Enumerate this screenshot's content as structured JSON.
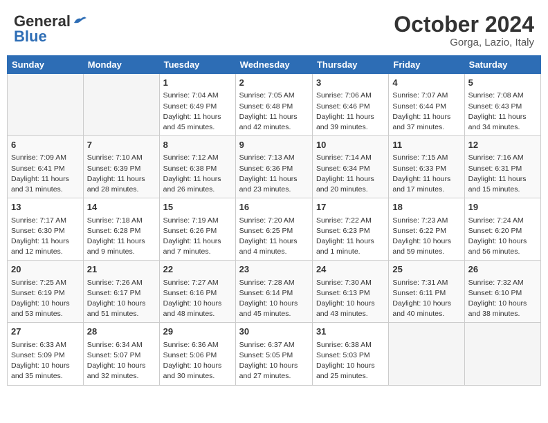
{
  "header": {
    "logo_general": "General",
    "logo_blue": "Blue",
    "month": "October 2024",
    "location": "Gorga, Lazio, Italy"
  },
  "weekdays": [
    "Sunday",
    "Monday",
    "Tuesday",
    "Wednesday",
    "Thursday",
    "Friday",
    "Saturday"
  ],
  "weeks": [
    [
      {
        "day": "",
        "empty": true
      },
      {
        "day": "",
        "empty": true
      },
      {
        "day": "1",
        "sunrise": "Sunrise: 7:04 AM",
        "sunset": "Sunset: 6:49 PM",
        "daylight": "Daylight: 11 hours and 45 minutes."
      },
      {
        "day": "2",
        "sunrise": "Sunrise: 7:05 AM",
        "sunset": "Sunset: 6:48 PM",
        "daylight": "Daylight: 11 hours and 42 minutes."
      },
      {
        "day": "3",
        "sunrise": "Sunrise: 7:06 AM",
        "sunset": "Sunset: 6:46 PM",
        "daylight": "Daylight: 11 hours and 39 minutes."
      },
      {
        "day": "4",
        "sunrise": "Sunrise: 7:07 AM",
        "sunset": "Sunset: 6:44 PM",
        "daylight": "Daylight: 11 hours and 37 minutes."
      },
      {
        "day": "5",
        "sunrise": "Sunrise: 7:08 AM",
        "sunset": "Sunset: 6:43 PM",
        "daylight": "Daylight: 11 hours and 34 minutes."
      }
    ],
    [
      {
        "day": "6",
        "sunrise": "Sunrise: 7:09 AM",
        "sunset": "Sunset: 6:41 PM",
        "daylight": "Daylight: 11 hours and 31 minutes."
      },
      {
        "day": "7",
        "sunrise": "Sunrise: 7:10 AM",
        "sunset": "Sunset: 6:39 PM",
        "daylight": "Daylight: 11 hours and 28 minutes."
      },
      {
        "day": "8",
        "sunrise": "Sunrise: 7:12 AM",
        "sunset": "Sunset: 6:38 PM",
        "daylight": "Daylight: 11 hours and 26 minutes."
      },
      {
        "day": "9",
        "sunrise": "Sunrise: 7:13 AM",
        "sunset": "Sunset: 6:36 PM",
        "daylight": "Daylight: 11 hours and 23 minutes."
      },
      {
        "day": "10",
        "sunrise": "Sunrise: 7:14 AM",
        "sunset": "Sunset: 6:34 PM",
        "daylight": "Daylight: 11 hours and 20 minutes."
      },
      {
        "day": "11",
        "sunrise": "Sunrise: 7:15 AM",
        "sunset": "Sunset: 6:33 PM",
        "daylight": "Daylight: 11 hours and 17 minutes."
      },
      {
        "day": "12",
        "sunrise": "Sunrise: 7:16 AM",
        "sunset": "Sunset: 6:31 PM",
        "daylight": "Daylight: 11 hours and 15 minutes."
      }
    ],
    [
      {
        "day": "13",
        "sunrise": "Sunrise: 7:17 AM",
        "sunset": "Sunset: 6:30 PM",
        "daylight": "Daylight: 11 hours and 12 minutes."
      },
      {
        "day": "14",
        "sunrise": "Sunrise: 7:18 AM",
        "sunset": "Sunset: 6:28 PM",
        "daylight": "Daylight: 11 hours and 9 minutes."
      },
      {
        "day": "15",
        "sunrise": "Sunrise: 7:19 AM",
        "sunset": "Sunset: 6:26 PM",
        "daylight": "Daylight: 11 hours and 7 minutes."
      },
      {
        "day": "16",
        "sunrise": "Sunrise: 7:20 AM",
        "sunset": "Sunset: 6:25 PM",
        "daylight": "Daylight: 11 hours and 4 minutes."
      },
      {
        "day": "17",
        "sunrise": "Sunrise: 7:22 AM",
        "sunset": "Sunset: 6:23 PM",
        "daylight": "Daylight: 11 hours and 1 minute."
      },
      {
        "day": "18",
        "sunrise": "Sunrise: 7:23 AM",
        "sunset": "Sunset: 6:22 PM",
        "daylight": "Daylight: 10 hours and 59 minutes."
      },
      {
        "day": "19",
        "sunrise": "Sunrise: 7:24 AM",
        "sunset": "Sunset: 6:20 PM",
        "daylight": "Daylight: 10 hours and 56 minutes."
      }
    ],
    [
      {
        "day": "20",
        "sunrise": "Sunrise: 7:25 AM",
        "sunset": "Sunset: 6:19 PM",
        "daylight": "Daylight: 10 hours and 53 minutes."
      },
      {
        "day": "21",
        "sunrise": "Sunrise: 7:26 AM",
        "sunset": "Sunset: 6:17 PM",
        "daylight": "Daylight: 10 hours and 51 minutes."
      },
      {
        "day": "22",
        "sunrise": "Sunrise: 7:27 AM",
        "sunset": "Sunset: 6:16 PM",
        "daylight": "Daylight: 10 hours and 48 minutes."
      },
      {
        "day": "23",
        "sunrise": "Sunrise: 7:28 AM",
        "sunset": "Sunset: 6:14 PM",
        "daylight": "Daylight: 10 hours and 45 minutes."
      },
      {
        "day": "24",
        "sunrise": "Sunrise: 7:30 AM",
        "sunset": "Sunset: 6:13 PM",
        "daylight": "Daylight: 10 hours and 43 minutes."
      },
      {
        "day": "25",
        "sunrise": "Sunrise: 7:31 AM",
        "sunset": "Sunset: 6:11 PM",
        "daylight": "Daylight: 10 hours and 40 minutes."
      },
      {
        "day": "26",
        "sunrise": "Sunrise: 7:32 AM",
        "sunset": "Sunset: 6:10 PM",
        "daylight": "Daylight: 10 hours and 38 minutes."
      }
    ],
    [
      {
        "day": "27",
        "sunrise": "Sunrise: 6:33 AM",
        "sunset": "Sunset: 5:09 PM",
        "daylight": "Daylight: 10 hours and 35 minutes."
      },
      {
        "day": "28",
        "sunrise": "Sunrise: 6:34 AM",
        "sunset": "Sunset: 5:07 PM",
        "daylight": "Daylight: 10 hours and 32 minutes."
      },
      {
        "day": "29",
        "sunrise": "Sunrise: 6:36 AM",
        "sunset": "Sunset: 5:06 PM",
        "daylight": "Daylight: 10 hours and 30 minutes."
      },
      {
        "day": "30",
        "sunrise": "Sunrise: 6:37 AM",
        "sunset": "Sunset: 5:05 PM",
        "daylight": "Daylight: 10 hours and 27 minutes."
      },
      {
        "day": "31",
        "sunrise": "Sunrise: 6:38 AM",
        "sunset": "Sunset: 5:03 PM",
        "daylight": "Daylight: 10 hours and 25 minutes."
      },
      {
        "day": "",
        "empty": true
      },
      {
        "day": "",
        "empty": true
      }
    ]
  ]
}
